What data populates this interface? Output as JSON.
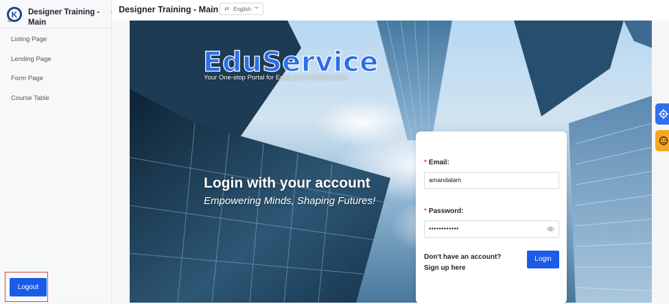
{
  "sidebar": {
    "brand_title": "Designer Training - Main",
    "logo_icon": "k-logo-icon",
    "collapse_icon": "chevron-left-icon",
    "items": [
      {
        "label": "Listing Page"
      },
      {
        "label": "Lending Page"
      },
      {
        "label": "Form Page"
      },
      {
        "label": "Course Table"
      }
    ],
    "logout_label": "Logout"
  },
  "header": {
    "title": "Designer Training - Main",
    "language": {
      "selected": "English",
      "icon": "swap-icon"
    }
  },
  "hero": {
    "logo_text": "EduService",
    "tagline": "Your One-stop Portal for Education Administration",
    "heading": "Login with your account",
    "subheading": "Empowering Minds, Shaping Futures!"
  },
  "login": {
    "email_label": "Email:",
    "email_value": "amandalam",
    "password_label": "Password:",
    "password_value": "••••••••••••",
    "signup_line1": "Don't have an account?",
    "signup_line2": "Sign up here",
    "login_label": "Login"
  },
  "floating": {
    "settings_icon": "gear-icon",
    "assistant_icon": "face-icon"
  },
  "colors": {
    "primary": "#1a5ce6",
    "required": "#f53f3f",
    "highlight": "#e0403a",
    "assistant": "#f5a623"
  }
}
